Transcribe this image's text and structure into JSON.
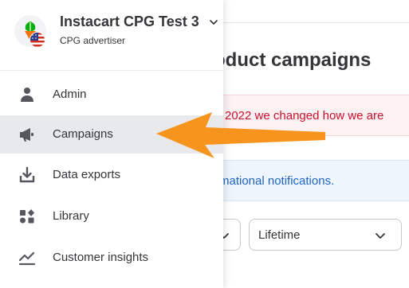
{
  "account": {
    "name": "Instacart CPG Test 3",
    "role": "CPG advertiser",
    "chevron_icon": "chevron-down-icon",
    "logo_icon": "carrot-icon",
    "flag_icon": "us-flag-icon"
  },
  "menu": {
    "items": [
      {
        "label": "Admin",
        "icon": "person-icon"
      },
      {
        "label": "Campaigns",
        "icon": "megaphone-icon",
        "active": true
      },
      {
        "label": "Data exports",
        "icon": "download-tray-icon"
      },
      {
        "label": "Library",
        "icon": "library-icon"
      },
      {
        "label": "Customer insights",
        "icon": "trend-line-icon"
      }
    ]
  },
  "page": {
    "title": "oduct campaigns",
    "alert_text": "2022 we changed how we are",
    "info_text": "rmational notifications.",
    "date_filter": {
      "selected": "Lifetime"
    }
  },
  "colors": {
    "accent_green": "#0aad0a",
    "carrot_orange": "#ff7009",
    "annotation_arrow": "#f7941d",
    "alert_red": "#c8102e",
    "info_blue": "#1f64c4",
    "active_item_bg": "#e8e9eb"
  }
}
